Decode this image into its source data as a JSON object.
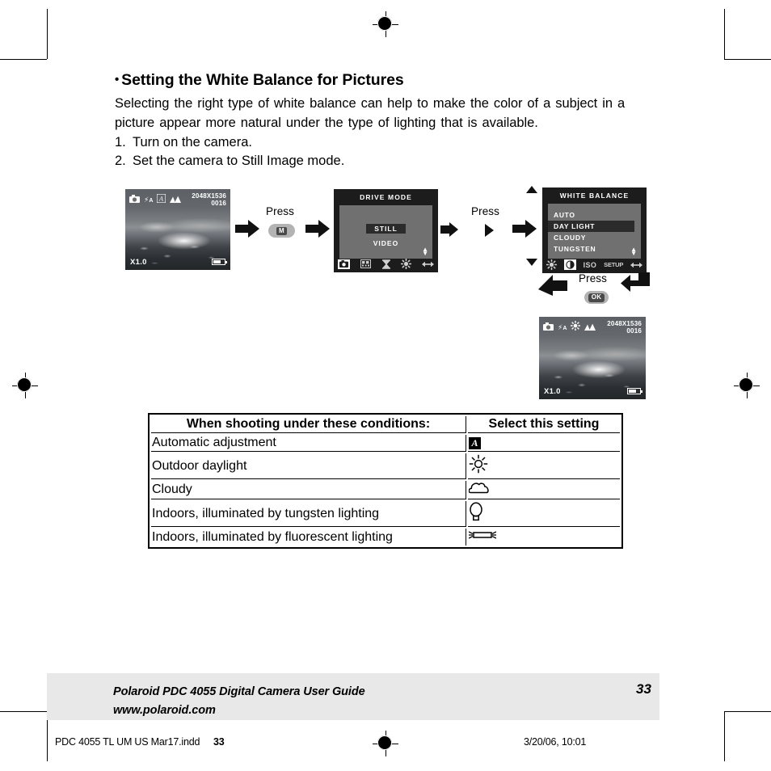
{
  "document": {
    "heading": "Setting the White Balance for Pictures",
    "heading_bullet": "•",
    "paragraph": "Selecting the right type of white balance can help to make the color of a subject in a picture appear more natural under the type of lighting that is available.",
    "steps": [
      {
        "num": "1.",
        "text": "Turn on the camera."
      },
      {
        "num": "2.",
        "text": "Set the camera to Still Image mode."
      }
    ]
  },
  "flow": {
    "press_label_1": "Press",
    "press_label_2": "Press",
    "press_label_3": "Press",
    "mode_button_label": "M",
    "ok_button_label": "OK",
    "lcd_before": {
      "resolution": "2048X1536",
      "counter": "0016",
      "zoom": "X1.0",
      "icons": [
        "camera-icon",
        "flash-auto-icon",
        "white-balance-auto-icon",
        "mountain-icon"
      ],
      "battery": "battery-icon"
    },
    "lcd_after": {
      "resolution": "2048X1536",
      "counter": "0016",
      "zoom": "X1.0",
      "icons": [
        "camera-icon",
        "flash-auto-icon",
        "daylight-sun-icon",
        "mountain-icon"
      ],
      "battery": "battery-icon"
    },
    "drive_mode_menu": {
      "title": "DRIVE MODE",
      "items": [
        "STILL",
        "VIDEO"
      ],
      "selected": "STILL",
      "tab_icons": [
        "camera-icon",
        "resolution-icon",
        "self-timer-icon",
        "brightness-icon",
        "left-right-arrow-icon"
      ],
      "selected_tab": "camera-icon"
    },
    "white_balance_menu": {
      "title": "WHITE BALANCE",
      "items": [
        "AUTO",
        "DAY LIGHT",
        "CLOUDY",
        "TUNGSTEN"
      ],
      "selected": "DAY LIGHT",
      "tab_icons": [
        "brightness-icon",
        "contrast-icon",
        "ISO",
        "SETUP",
        "left-right-arrow-icon"
      ],
      "selected_tab": "contrast-icon"
    }
  },
  "table": {
    "headers": [
      "When shooting under these conditions:",
      "Select this setting"
    ],
    "rows": [
      {
        "condition": "Automatic adjustment",
        "setting_icon": "white-balance-auto-icon"
      },
      {
        "condition": "Outdoor daylight",
        "setting_icon": "sun-icon"
      },
      {
        "condition": "Cloudy",
        "setting_icon": "cloud-icon"
      },
      {
        "condition": "Indoors, illuminated by tungsten lighting",
        "setting_icon": "light-bulb-icon"
      },
      {
        "condition": "Indoors, illuminated by fluorescent lighting",
        "setting_icon": "fluorescent-tube-icon"
      }
    ]
  },
  "footer": {
    "guide_title": "Polaroid PDC 4055 Digital Camera User Guide",
    "website": "www.polaroid.com",
    "page_number": "33",
    "print_file": "PDC 4055 TL UM US Mar17.indd",
    "print_overlap": "33",
    "print_timestamp": "3/20/06, 10:01"
  },
  "colors": {
    "footer_band": "#e8e8e8",
    "lcd_background": "#6d6d6d",
    "menu_background": "#1c1c1c",
    "menu_panel": "#707070",
    "selection": "#2b2b2b",
    "button": "#b3b3b3"
  }
}
